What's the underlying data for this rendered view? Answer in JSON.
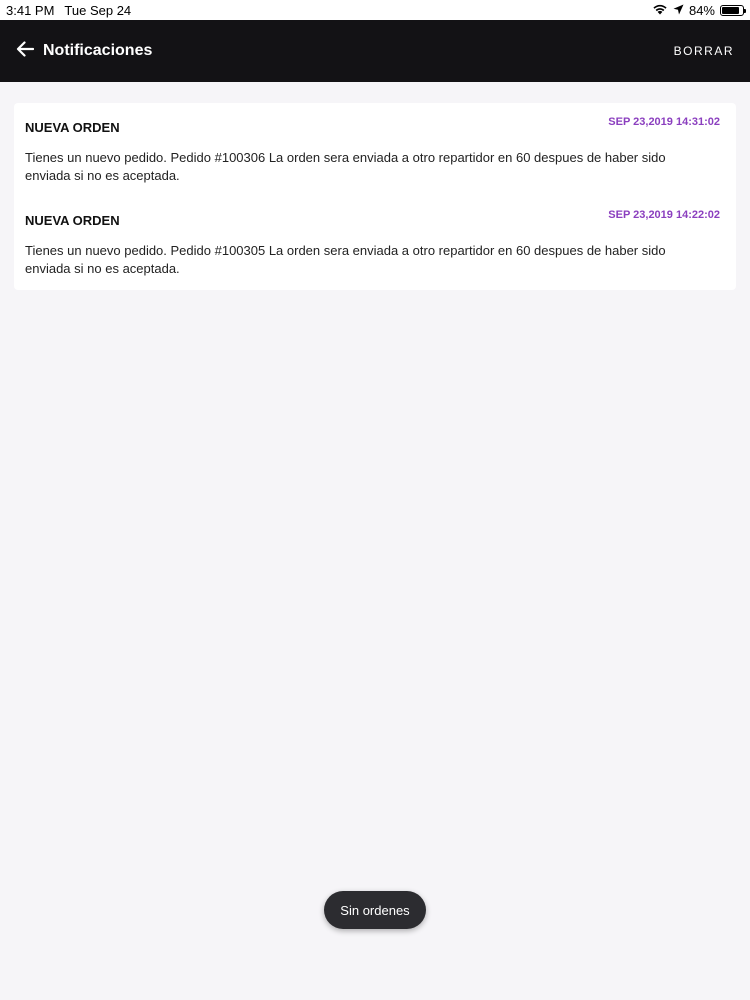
{
  "status_bar": {
    "time": "3:41 PM",
    "date": "Tue Sep 24",
    "battery": "84%",
    "battery_level": 0.84,
    "icons": [
      "wifi-icon",
      "location-arrow-icon",
      "battery-icon"
    ]
  },
  "app_bar": {
    "back_icon": "arrow-left-icon",
    "title": "Notificaciones",
    "clear_label": "BORRAR"
  },
  "notifications": [
    {
      "title": "NUEVA ORDEN",
      "date": "SEP 23,2019 14:31:02",
      "body": "Tienes un nuevo pedido. Pedido #100306 La orden sera enviada a otro repartidor en 60 despues de haber sido enviada si no es aceptada."
    },
    {
      "title": "NUEVA ORDEN",
      "date": "SEP 23,2019 14:22:02",
      "body": "Tienes un nuevo pedido. Pedido #100305 La orden sera enviada a otro repartidor en 60 despues de haber sido enviada si no es aceptada."
    }
  ],
  "toast": {
    "text": "Sin ordenes"
  },
  "colors": {
    "app_bar": "#131215",
    "accent_date": "#8b3fbf",
    "background": "#f6f5f8"
  }
}
